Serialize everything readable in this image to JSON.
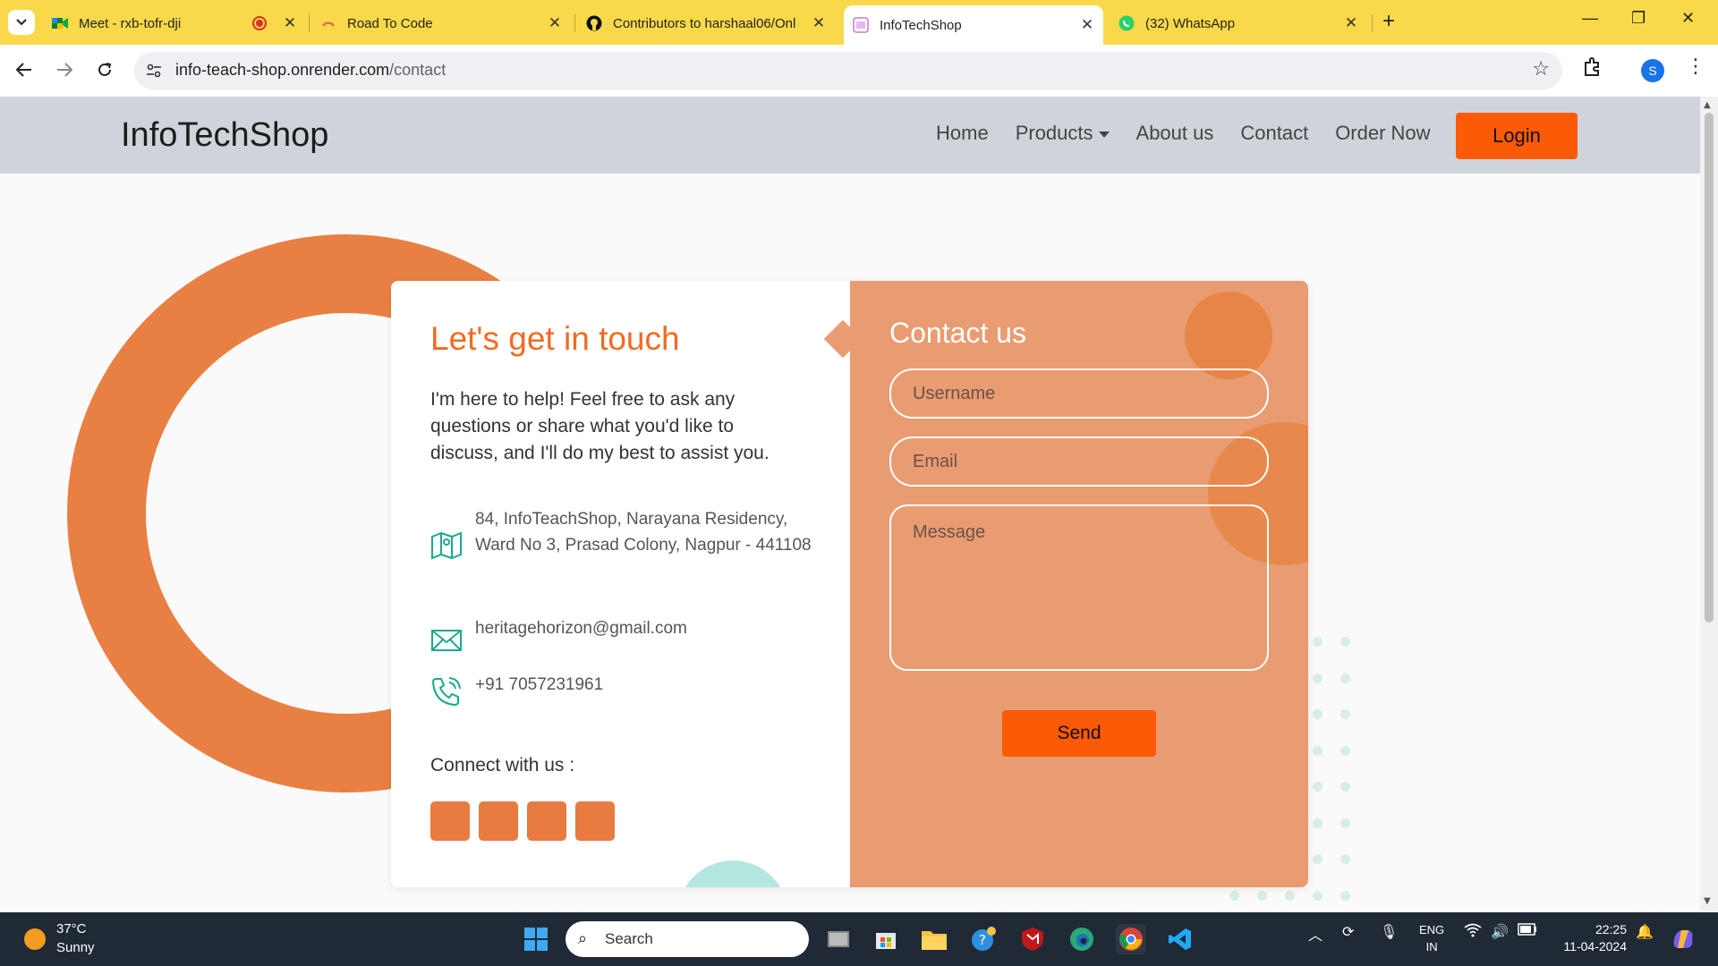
{
  "browser": {
    "tabs": [
      {
        "title": "Meet - rxb-tofr-dji",
        "icon": "meet-icon",
        "active": false,
        "recording": true
      },
      {
        "title": "Road To Code",
        "icon": "loading-icon",
        "active": false
      },
      {
        "title": "Contributors to harshaal06/Onl",
        "icon": "github-icon",
        "active": false
      },
      {
        "title": "InfoTechShop",
        "icon": "site-icon",
        "active": true
      },
      {
        "title": "(32) WhatsApp",
        "icon": "whatsapp-icon",
        "active": false
      }
    ],
    "url_host": "info-teach-shop.onrender.com",
    "url_path": "/contact",
    "profile_initial": "S",
    "tab_bar_color": "#f9d94a"
  },
  "site": {
    "brand": "InfoTechShop",
    "nav": {
      "home": "Home",
      "products": "Products",
      "about": "About us",
      "contact": "Contact",
      "order": "Order Now",
      "login": "Login"
    },
    "accent_color": "#fb5a06",
    "card": {
      "touch_title": "Let's get in touch",
      "touch_text": "I'm here to help! Feel free to ask any questions or share what you'd like to discuss, and I'll do my best to assist you.",
      "address": "84, InfoTeachShop, Narayana Residency, Ward No 3, Prasad Colony, Nagpur - 441108",
      "email": "heritagehorizon@gmail.com",
      "phone": "+91 7057231961",
      "connect": "Connect with us :",
      "contact_title": "Contact us",
      "username_placeholder": "Username",
      "email_placeholder": "Email",
      "message_placeholder": "Message",
      "send": "Send"
    }
  },
  "taskbar": {
    "temperature": "37°C",
    "condition": "Sunny",
    "search_label": "Search",
    "lang_line1": "ENG",
    "lang_line2": "IN",
    "time": "22:25",
    "date": "11-04-2024"
  }
}
